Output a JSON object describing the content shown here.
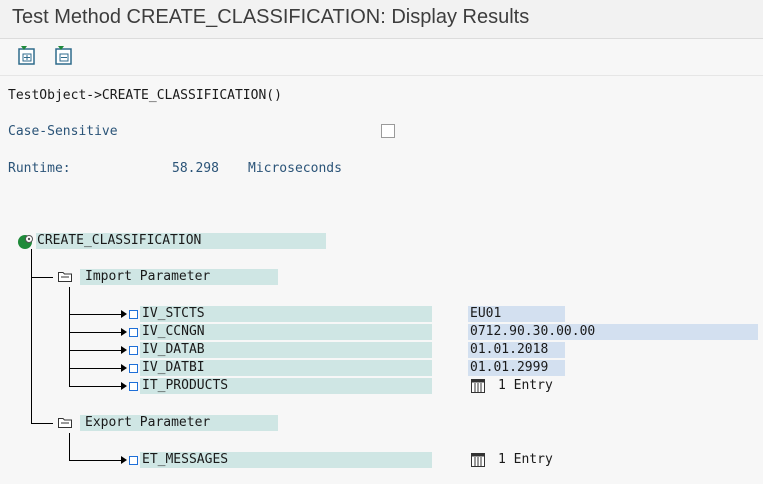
{
  "window": {
    "title": "Test Method CREATE_CLASSIFICATION: Display Results"
  },
  "toolbar": {
    "buttons": [
      {
        "icon": "insert-icon"
      },
      {
        "icon": "remove-icon"
      }
    ]
  },
  "header": {
    "call": "TestObject->CREATE_CLASSIFICATION()",
    "case_sensitive_label": "Case-Sensitive",
    "case_sensitive_checked": false,
    "runtime_label": "Runtime:",
    "runtime_value": "58.298",
    "runtime_unit": "Microseconds"
  },
  "tree": {
    "root": "CREATE_CLASSIFICATION",
    "import_label": "Import Parameter",
    "export_label": "Export Parameter",
    "import_params": [
      {
        "name": "IV_STCTS",
        "value": "EU01"
      },
      {
        "name": "IV_CCNGN",
        "value": "0712.90.30.00.00"
      },
      {
        "name": "IV_DATAB",
        "value": "01.01.2018"
      },
      {
        "name": "IV_DATBI",
        "value": "01.01.2999"
      },
      {
        "name": "IT_PRODUCTS",
        "value": "1 Entry"
      }
    ],
    "export_params": [
      {
        "name": "ET_MESSAGES",
        "value": "1 Entry"
      }
    ]
  },
  "colors": {
    "highlight": "#cfe6e4",
    "value_highlight": "#d3e0f0",
    "label_blue": "#2b5478",
    "icon_green": "#1f8a3a"
  }
}
